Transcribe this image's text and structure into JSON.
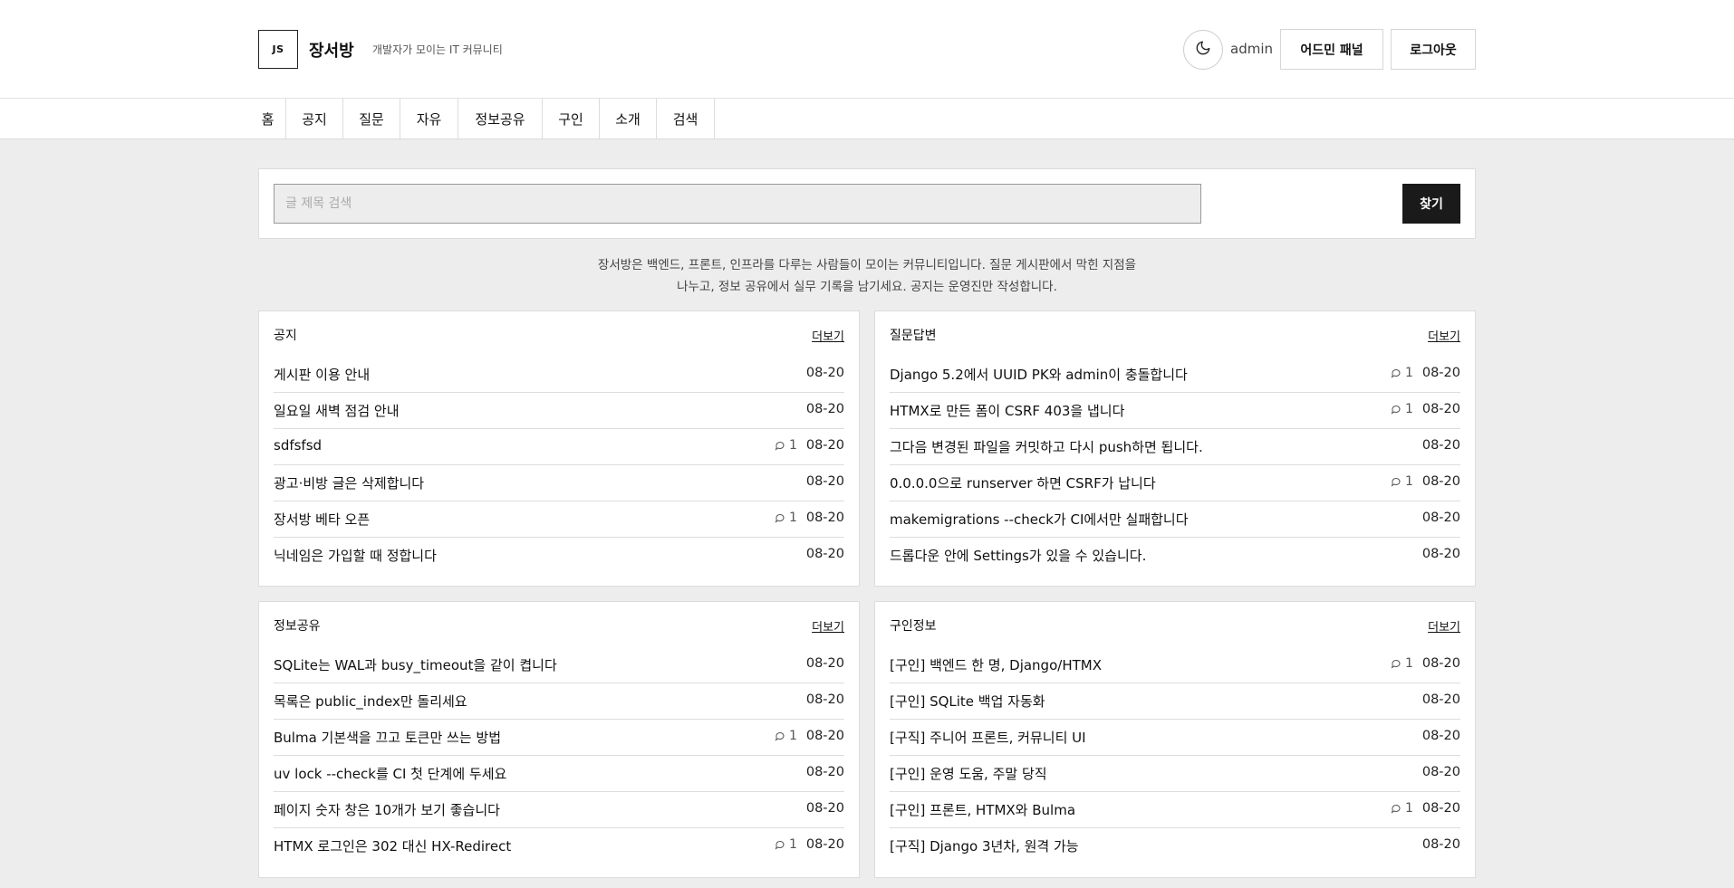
{
  "header": {
    "logo_text": "JS",
    "site_name": "장서방",
    "tagline": "개발자가 모이는 IT 커뮤니티",
    "theme_icon": "moon-icon",
    "username": "admin",
    "admin_button": "어드민 패널",
    "logout_button": "로그아웃"
  },
  "nav": {
    "items": [
      {
        "label": "홈"
      },
      {
        "label": "공지"
      },
      {
        "label": "질문"
      },
      {
        "label": "자유"
      },
      {
        "label": "정보공유"
      },
      {
        "label": "구인"
      },
      {
        "label": "소개"
      },
      {
        "label": "검색"
      }
    ]
  },
  "search": {
    "placeholder": "글 제목 검색",
    "value": "",
    "button_label": "찾기"
  },
  "intro": {
    "line1": "장서방은 백엔드, 프론트, 인프라를 다루는 사람들이 모이는 커뮤니티입니다. 질문 게시판에서 막힌 지점을",
    "line2": "나누고, 정보 공유에서 실무 기록을 남기세요. 공지는 운영진만 작성합니다."
  },
  "boards": [
    {
      "title": "공지",
      "more": "더보기",
      "posts": [
        {
          "title": "게시판 이용 안내",
          "comments": "",
          "date": "08-20"
        },
        {
          "title": "일요일 새벽 점검 안내",
          "comments": "",
          "date": "08-20"
        },
        {
          "title": "sdfsfsd",
          "comments": "1",
          "date": "08-20"
        },
        {
          "title": "광고·비방 글은 삭제합니다",
          "comments": "",
          "date": "08-20"
        },
        {
          "title": "장서방 베타 오픈",
          "comments": "1",
          "date": "08-20"
        },
        {
          "title": "닉네임은 가입할 때 정합니다",
          "comments": "",
          "date": "08-20"
        }
      ]
    },
    {
      "title": "질문답변",
      "more": "더보기",
      "posts": [
        {
          "title": "Django 5.2에서 UUID PK와 admin이 충돌합니다",
          "comments": "1",
          "date": "08-20"
        },
        {
          "title": "HTMX로 만든 폼이 CSRF 403을 냅니다",
          "comments": "1",
          "date": "08-20"
        },
        {
          "title": "그다음 변경된 파일을 커밋하고 다시 push하면 됩니다.",
          "comments": "",
          "date": "08-20"
        },
        {
          "title": "0.0.0.0으로 runserver 하면 CSRF가 납니다",
          "comments": "1",
          "date": "08-20"
        },
        {
          "title": "makemigrations --check가 CI에서만 실패합니다",
          "comments": "",
          "date": "08-20"
        },
        {
          "title": "드롭다운 안에 Settings가 있을 수 있습니다.",
          "comments": "",
          "date": "08-20"
        }
      ]
    },
    {
      "title": "정보공유",
      "more": "더보기",
      "posts": [
        {
          "title": "SQLite는 WAL과 busy_timeout을 같이 켭니다",
          "comments": "",
          "date": "08-20"
        },
        {
          "title": "목록은 public_index만 돌리세요",
          "comments": "",
          "date": "08-20"
        },
        {
          "title": "Bulma 기본색을 끄고 토큰만 쓰는 방법",
          "comments": "1",
          "date": "08-20"
        },
        {
          "title": "uv lock --check를 CI 첫 단계에 두세요",
          "comments": "",
          "date": "08-20"
        },
        {
          "title": "페이지 숫자 창은 10개가 보기 좋습니다",
          "comments": "",
          "date": "08-20"
        },
        {
          "title": "HTMX 로그인은 302 대신 HX-Redirect",
          "comments": "1",
          "date": "08-20"
        }
      ]
    },
    {
      "title": "구인정보",
      "more": "더보기",
      "posts": [
        {
          "title": "[구인] 백엔드 한 명, Django/HTMX",
          "comments": "1",
          "date": "08-20"
        },
        {
          "title": "[구인] SQLite 백업 자동화",
          "comments": "",
          "date": "08-20"
        },
        {
          "title": "[구직] 주니어 프론트, 커뮤니티 UI",
          "comments": "",
          "date": "08-20"
        },
        {
          "title": "[구인] 운영 도움, 주말 당직",
          "comments": "",
          "date": "08-20"
        },
        {
          "title": "[구인] 프론트, HTMX와 Bulma",
          "comments": "1",
          "date": "08-20"
        },
        {
          "title": "[구직] Django 3년차, 원격 가능",
          "comments": "",
          "date": "08-20"
        }
      ]
    }
  ]
}
